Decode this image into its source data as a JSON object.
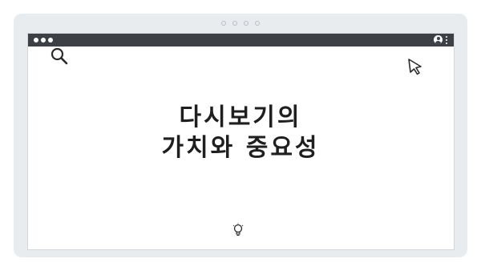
{
  "window": {
    "title_dots": [
      "close",
      "minimize",
      "maximize"
    ],
    "right_icons": [
      "user-icon",
      "kebab-icon"
    ]
  },
  "content": {
    "headline_line1": "다시보기의",
    "headline_line2": "가치와 중요성"
  },
  "icons": {
    "top_left": "search-icon",
    "top_right": "cursor-icon",
    "bottom": "lightbulb-icon"
  },
  "colors": {
    "frame": "#e9ecef",
    "titlebar": "#3d4146",
    "text": "#1f1f1f"
  }
}
